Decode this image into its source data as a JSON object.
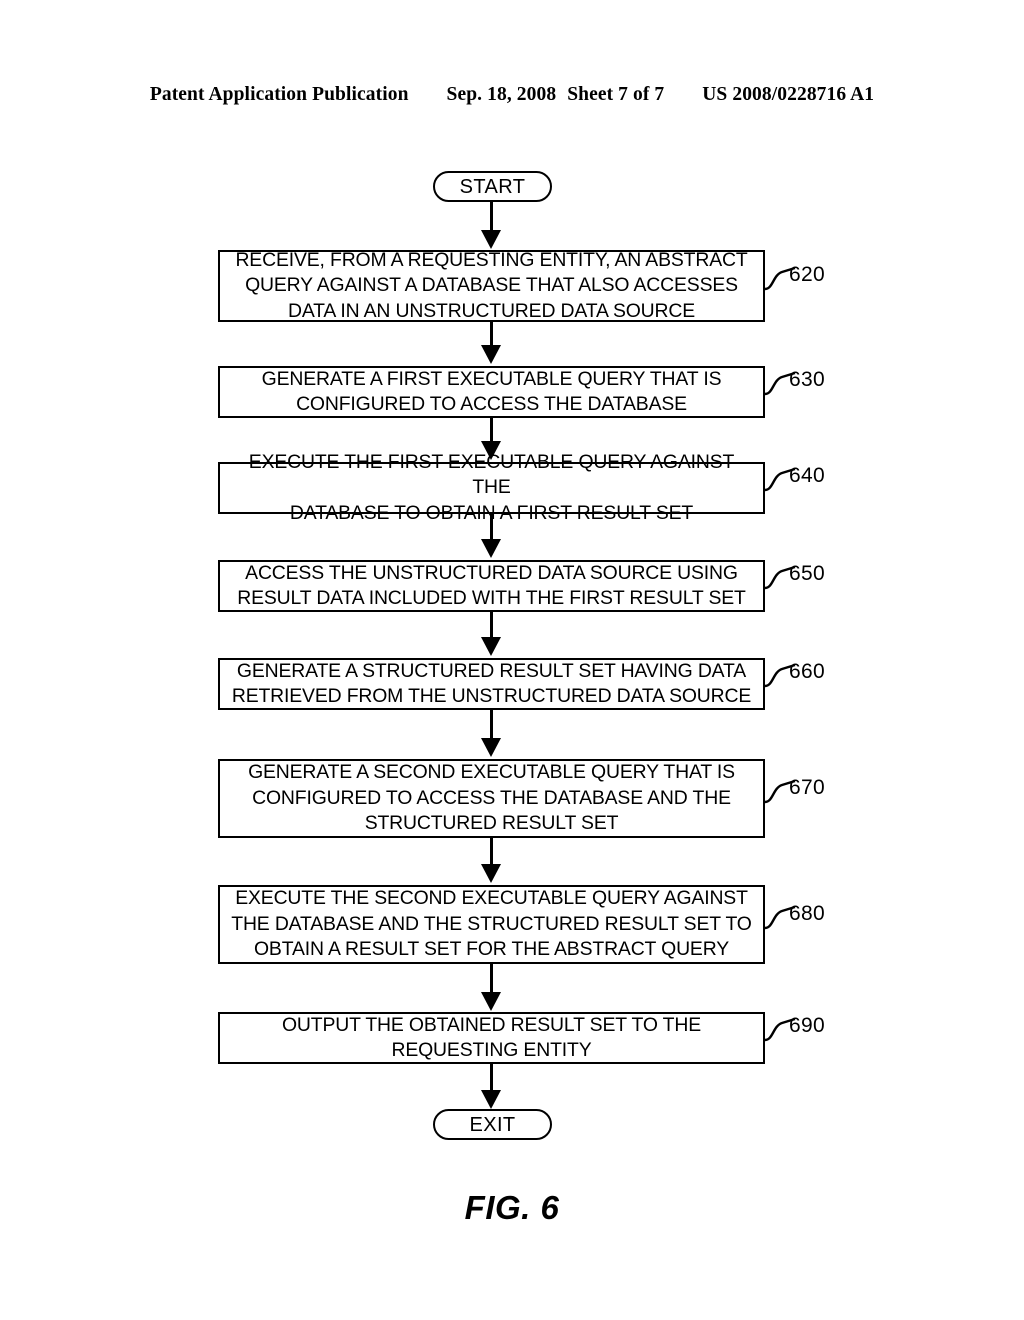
{
  "header": {
    "publication": "Patent Application Publication",
    "date": "Sep. 18, 2008",
    "sheet": "Sheet 7 of 7",
    "patent_number": "US 2008/0228716 A1"
  },
  "figure": {
    "caption": "FIG. 6",
    "start_label": "START",
    "exit_label": "EXIT"
  },
  "steps": [
    {
      "ref": "620",
      "text": "RECEIVE, FROM A REQUESTING ENTITY, AN ABSTRACT\nQUERY AGAINST A DATABASE THAT ALSO ACCESSES\nDATA IN AN UNSTRUCTURED DATA SOURCE"
    },
    {
      "ref": "630",
      "text": "GENERATE A FIRST EXECUTABLE QUERY THAT IS\nCONFIGURED TO ACCESS THE DATABASE"
    },
    {
      "ref": "640",
      "text": "EXECUTE THE FIRST EXECUTABLE QUERY AGAINST THE\nDATABASE TO OBTAIN A FIRST RESULT SET"
    },
    {
      "ref": "650",
      "text": "ACCESS THE UNSTRUCTURED DATA SOURCE USING\nRESULT DATA INCLUDED WITH THE FIRST RESULT SET"
    },
    {
      "ref": "660",
      "text": "GENERATE A STRUCTURED RESULT SET HAVING DATA\nRETRIEVED FROM THE UNSTRUCTURED DATA SOURCE"
    },
    {
      "ref": "670",
      "text": "GENERATE A SECOND EXECUTABLE QUERY THAT IS\nCONFIGURED TO ACCESS THE DATABASE AND THE\nSTRUCTURED RESULT SET"
    },
    {
      "ref": "680",
      "text": "EXECUTE THE SECOND EXECUTABLE QUERY AGAINST\nTHE DATABASE AND THE STRUCTURED RESULT SET TO\nOBTAIN A RESULT SET FOR THE ABSTRACT QUERY"
    },
    {
      "ref": "690",
      "text": "OUTPUT THE OBTAINED RESULT SET TO THE\nREQUESTING ENTITY"
    }
  ],
  "colors": {
    "ink": "#000000",
    "paper": "#ffffff"
  }
}
